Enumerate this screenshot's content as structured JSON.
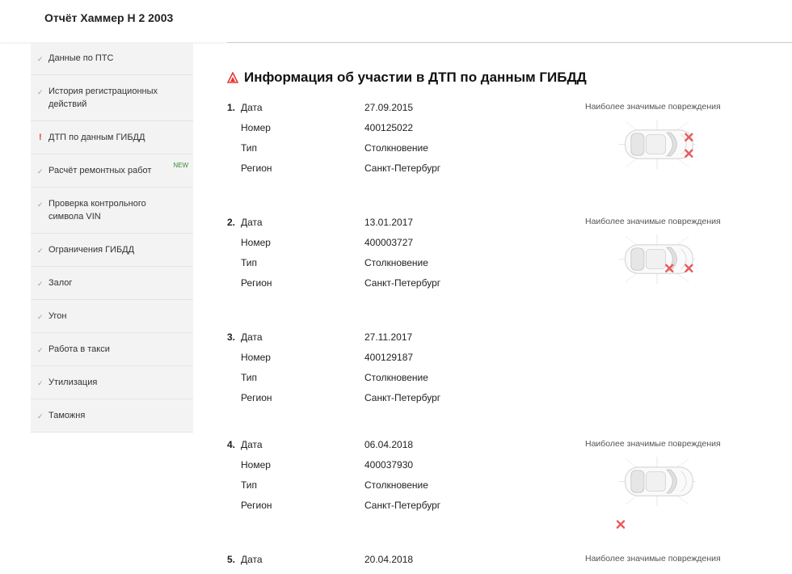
{
  "header": {
    "title": "Отчёт Хаммер H 2 2003"
  },
  "sidebar": {
    "items": [
      {
        "label": "Данные по ПТС",
        "status": "ok"
      },
      {
        "label": "История регистрационных действий",
        "status": "ok"
      },
      {
        "label": "ДТП по данным ГИБДД",
        "status": "alert"
      },
      {
        "label": "Расчёт ремонтных работ",
        "status": "ok",
        "badge": "NEW"
      },
      {
        "label": "Проверка контрольного символа VIN",
        "status": "ok"
      },
      {
        "label": "Ограничения ГИБДД",
        "status": "ok"
      },
      {
        "label": "Залог",
        "status": "ok"
      },
      {
        "label": "Угон",
        "status": "ok"
      },
      {
        "label": "Работа в такси",
        "status": "ok"
      },
      {
        "label": "Утилизация",
        "status": "ok"
      },
      {
        "label": "Таможня",
        "status": "ok"
      }
    ]
  },
  "main": {
    "heading": "Информация об участии в ДТП по данным ГИБДД",
    "labels": {
      "date": "Дата",
      "number": "Номер",
      "type": "Тип",
      "region": "Регион"
    },
    "damage_title": "Наиболее значимые повреждения",
    "accidents": [
      {
        "index": "1.",
        "date": "27.09.2015",
        "number": "400125022",
        "type": "Столкновение",
        "region": "Санкт-Петербург",
        "damage": [
          "front-left",
          "front-right"
        ]
      },
      {
        "index": "2.",
        "date": "13.01.2017",
        "number": "400003727",
        "type": "Столкновение",
        "region": "Санкт-Петербург",
        "damage": [
          "right-side",
          "front-right"
        ]
      },
      {
        "index": "3.",
        "date": "27.11.2017",
        "number": "400129187",
        "type": "Столкновение",
        "region": "Санкт-Петербург",
        "damage": []
      },
      {
        "index": "4.",
        "date": "06.04.2018",
        "number": "400037930",
        "type": "Столкновение",
        "region": "Санкт-Петербург",
        "damage": [
          "bottom"
        ]
      },
      {
        "index": "5.",
        "date": "20.04.2018",
        "number": "",
        "type": "",
        "region": "",
        "damage": []
      }
    ]
  },
  "colors": {
    "alert": "#e53935",
    "check": "#9aa09a",
    "badge": "#3a8a3a",
    "damage": "#e85a5a"
  }
}
